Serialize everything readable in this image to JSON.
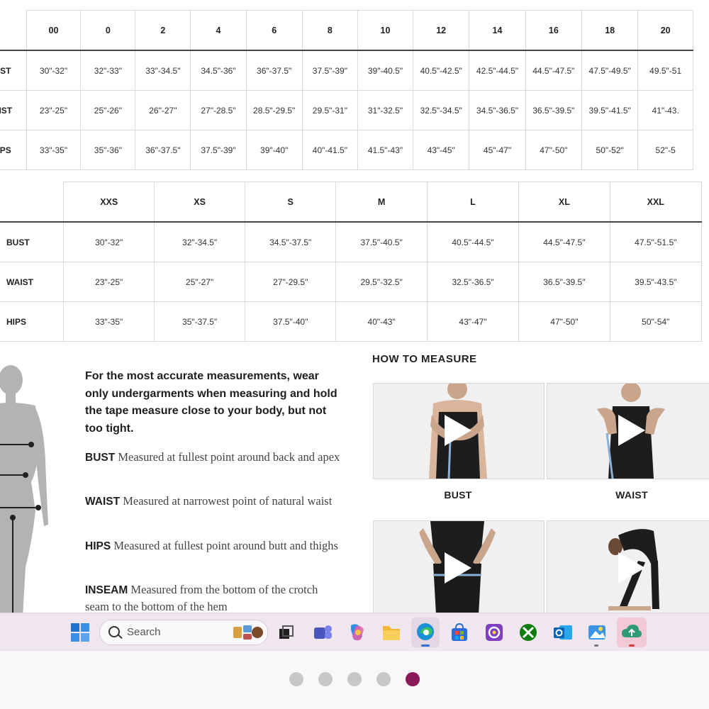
{
  "numeric_table": {
    "headers": [
      "00",
      "0",
      "2",
      "4",
      "6",
      "8",
      "10",
      "12",
      "14",
      "16",
      "18",
      "20"
    ],
    "rows": [
      {
        "label": "ST",
        "cells": [
          "30\"-32\"",
          "32\"-33\"",
          "33\"-34.5\"",
          "34.5\"-36\"",
          "36\"-37.5\"",
          "37.5\"-39\"",
          "39\"-40.5\"",
          "40.5\"-42.5\"",
          "42.5\"-44.5\"",
          "44.5\"-47.5\"",
          "47.5\"-49.5\"",
          "49.5\"-51"
        ]
      },
      {
        "label": "IST",
        "cells": [
          "23\"-25\"",
          "25\"-26\"",
          "26\"-27\"",
          "27\"-28.5\"",
          "28.5\"-29.5\"",
          "29.5\"-31\"",
          "31\"-32.5\"",
          "32.5\"-34.5\"",
          "34.5\"-36.5\"",
          "36.5\"-39.5\"",
          "39.5\"-41.5\"",
          "41\"-43."
        ]
      },
      {
        "label": "PS",
        "cells": [
          "33\"-35\"",
          "35\"-36\"",
          "36\"-37.5\"",
          "37.5\"-39\"",
          "39\"-40\"",
          "40\"-41.5\"",
          "41.5\"-43\"",
          "43\"-45\"",
          "45\"-47\"",
          "47\"-50\"",
          "50\"-52\"",
          "52\"-5"
        ]
      }
    ]
  },
  "letter_table": {
    "headers": [
      "XXS",
      "XS",
      "S",
      "M",
      "L",
      "XL",
      "XXL"
    ],
    "rows": [
      {
        "label": "BUST",
        "cells": [
          "30\"-32\"",
          "32\"-34.5\"",
          "34.5\"-37.5\"",
          "37.5\"-40.5\"",
          "40.5\"-44.5\"",
          "44.5\"-47.5\"",
          "47.5\"-51.5\""
        ]
      },
      {
        "label": "WAIST",
        "cells": [
          "23\"-25\"",
          "25\"-27\"",
          "27\"-29.5\"",
          "29.5\"-32.5\"",
          "32.5\"-36.5\"",
          "36.5\"-39.5\"",
          "39.5\"-43.5\""
        ]
      },
      {
        "label": "HIPS",
        "cells": [
          "33\"-35\"",
          "35\"-37.5\"",
          "37.5\"-40\"",
          "40\"-43\"",
          "43\"-47\"",
          "47\"-50\"",
          "50\"-54\""
        ]
      }
    ]
  },
  "guide": {
    "intro": "For the most accurate measurements, wear only undergarments when measuring and hold the tape measure close to your body, but not too tight.",
    "measurements": [
      {
        "term": "BUST",
        "desc": "Measured at fullest point around back and apex"
      },
      {
        "term": "WAIST",
        "desc": "Measured at narrowest point of natural waist"
      },
      {
        "term": "HIPS",
        "desc": "Measured at fullest point around butt and thighs"
      },
      {
        "term": "INSEAM",
        "desc": "Measured from the bottom of the crotch seam to the bottom of the hem"
      }
    ]
  },
  "how_to_measure": {
    "title": "HOW TO MEASURE",
    "videos": [
      {
        "label": "BUST"
      },
      {
        "label": "WAIST"
      }
    ]
  },
  "taskbar": {
    "search_placeholder": "Search",
    "icons": [
      "windows-start-icon",
      "search-icon",
      "widgets-icon",
      "task-view-icon",
      "teams-icon",
      "copilot-icon",
      "file-explorer-icon",
      "edge-icon",
      "store-icon",
      "photos-app-icon",
      "xbox-icon",
      "outlook-icon",
      "photos-icon",
      "cloud-upload-icon"
    ],
    "accent": "#0067c0"
  },
  "carousel": {
    "total": 5,
    "active_index": 4,
    "active_color": "#8a1a5a",
    "inactive_color": "#c7c7c7"
  }
}
